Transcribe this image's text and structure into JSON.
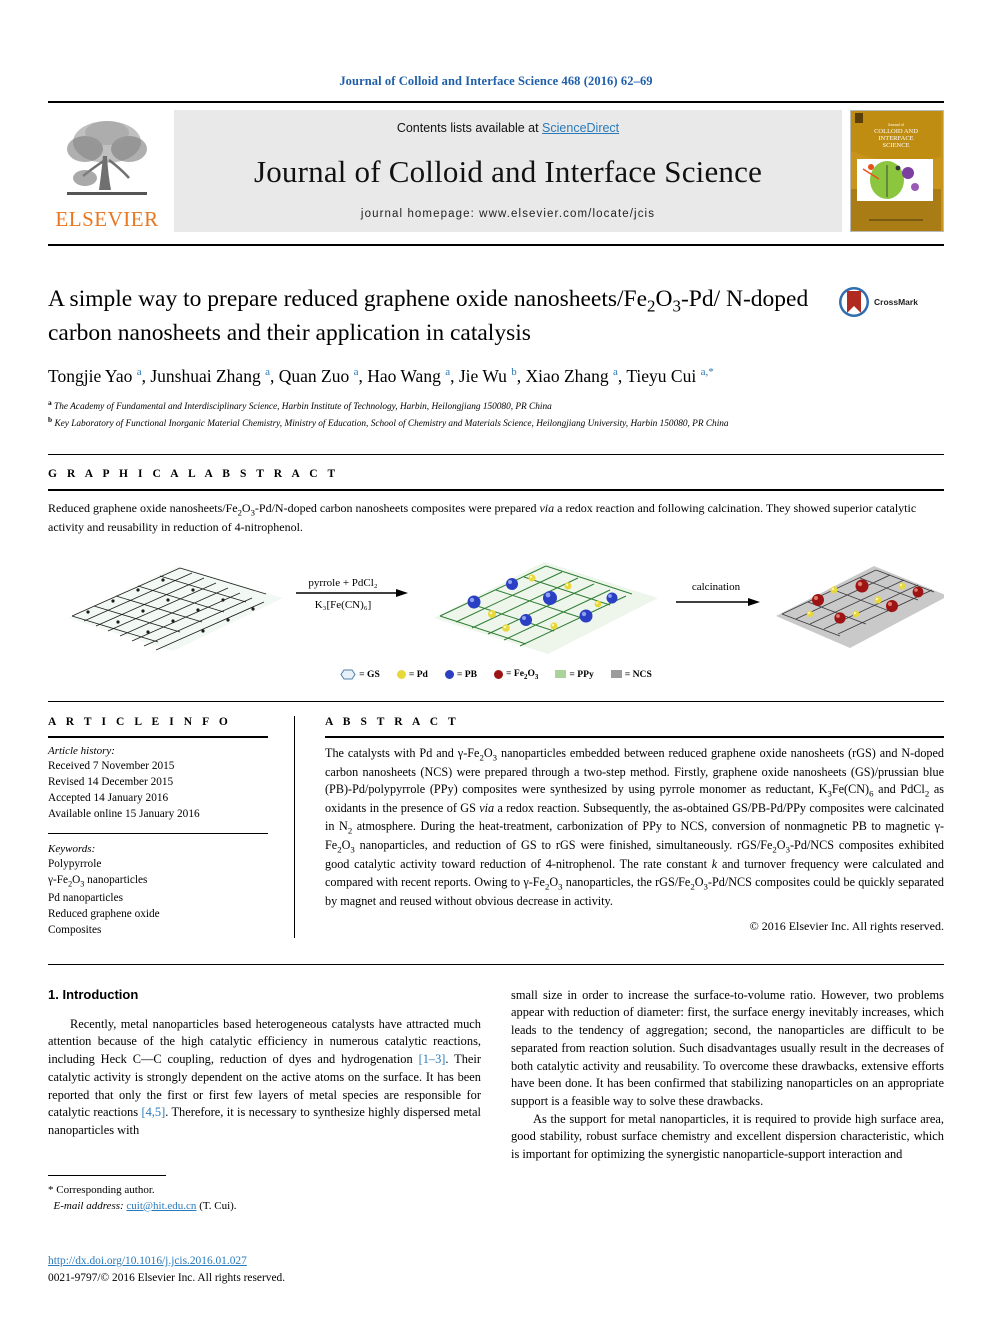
{
  "running_head": "Journal of Colloid and Interface Science 468 (2016) 62–69",
  "masthead": {
    "contents_prefix": "Contents lists available at ",
    "sciencedirect": "ScienceDirect",
    "journal_name": "Journal of Colloid and Interface Science",
    "homepage": "journal homepage: www.elsevier.com/locate/jcis",
    "publisher": "ELSEVIER",
    "cover_title": "COLLOID AND INTERFACE SCIENCE",
    "cover_overline": "Journal of"
  },
  "article": {
    "title_line1": "A simple way to prepare reduced graphene oxide nanosheets/Fe",
    "title_full": "A simple way to prepare reduced graphene oxide nanosheets/Fe2O3-Pd/ N-doped carbon nanosheets and their application in catalysis",
    "crossmark_label": "CrossMark",
    "authors": [
      {
        "name": "Tongjie Yao",
        "mark": "a"
      },
      {
        "name": "Junshuai Zhang",
        "mark": "a"
      },
      {
        "name": "Quan Zuo",
        "mark": "a"
      },
      {
        "name": "Hao Wang",
        "mark": "a"
      },
      {
        "name": "Jie Wu",
        "mark": "b"
      },
      {
        "name": "Xiao Zhang",
        "mark": "a"
      },
      {
        "name": "Tieyu Cui",
        "mark": "a,*"
      }
    ],
    "affiliations": [
      {
        "mark": "a",
        "text": "The Academy of Fundamental and Interdisciplinary Science, Harbin Institute of Technology, Harbin, Heilongjiang 150080, PR China"
      },
      {
        "mark": "b",
        "text": "Key Laboratory of Functional Inorganic Material Chemistry, Ministry of Education, School of Chemistry and Materials Science, Heilongjiang University, Harbin 150080, PR China"
      }
    ]
  },
  "graphical_abstract": {
    "heading": "G R A P H I C A L   A B S T R A C T",
    "text": "Reduced graphene oxide nanosheets/Fe2O3-Pd/N-doped carbon nanosheets composites were prepared via a redox reaction and following calcination. They showed superior catalytic activity and reusability in reduction of 4-nitrophenol.",
    "arrow1_top": "pyrrole + PdCl2",
    "arrow1_bottom": "K3[Fe(CN)6]",
    "arrow2_top": "calcination",
    "legend": [
      {
        "key": "GS",
        "symbol": "hexagon",
        "color": "#e8f1f8"
      },
      {
        "key": "Pd",
        "symbol": "dot",
        "color": "#e8d83c"
      },
      {
        "key": "PB",
        "symbol": "dot",
        "color": "#2b3fc4"
      },
      {
        "key": "Fe2O3",
        "symbol": "dot",
        "color": "#9e1414"
      },
      {
        "key": "PPy",
        "symbol": "square",
        "color": "#a9d39a"
      },
      {
        "key": "NCS",
        "symbol": "square",
        "color": "#9b9b9b"
      }
    ]
  },
  "article_info": {
    "heading": "A R T I C L E   I N F O",
    "history_title": "Article history:",
    "history": [
      "Received 7 November 2015",
      "Revised 14 December 2015",
      "Accepted 14 January 2016",
      "Available online 15 January 2016"
    ],
    "keywords_title": "Keywords:",
    "keywords": [
      "Polypyrrole",
      "γ-Fe2O3 nanoparticles",
      "Pd nanoparticles",
      "Reduced graphene oxide",
      "Composites"
    ]
  },
  "abstract": {
    "heading": "A B S T R A C T",
    "text": "The catalysts with Pd and γ-Fe2O3 nanoparticles embedded between reduced graphene oxide nanosheets (rGS) and N-doped carbon nanosheets (NCS) were prepared through a two-step method. Firstly, graphene oxide nanosheets (GS)/prussian blue (PB)-Pd/polypyrrole (PPy) composites were synthesized by using pyrrole monomer as reductant, K3Fe(CN)6 and PdCl2 as oxidants in the presence of GS via a redox reaction. Subsequently, the as-obtained GS/PB-Pd/PPy composites were calcinated in N2 atmosphere. During the heat-treatment, carbonization of PPy to NCS, conversion of nonmagnetic PB to magnetic γ-Fe2O3 nanoparticles, and reduction of GS to rGS were finished, simultaneously. rGS/Fe2O3-Pd/NCS composites exhibited good catalytic activity toward reduction of 4-nitrophenol. The rate constant k and turnover frequency were calculated and compared with recent reports. Owing to γ-Fe2O3 nanoparticles, the rGS/Fe2O3-Pd/NCS composites could be quickly separated by magnet and reused without obvious decrease in activity.",
    "copyright": "© 2016 Elsevier Inc. All rights reserved."
  },
  "body": {
    "section_title": "1. Introduction",
    "left_paragraph": "Recently, metal nanoparticles based heterogeneous catalysts have attracted much attention because of the high catalytic efficiency in numerous catalytic reactions, including Heck C—C coupling, reduction of dyes and hydrogenation [1–3]. Their catalytic activity is strongly dependent on the active atoms on the surface. It has been reported that only the first or first few layers of metal species are responsible for catalytic reactions [4,5]. Therefore, it is necessary to synthesize highly dispersed metal nanoparticles with",
    "right_paragraph_1": "small size in order to increase the surface-to-volume ratio. However, two problems appear with reduction of diameter: first, the surface energy inevitably increases, which leads to the tendency of aggregation; second, the nanoparticles are difficult to be separated from reaction solution. Such disadvantages usually result in the decreases of both catalytic activity and reusability. To overcome these drawbacks, extensive efforts have been done. It has been confirmed that stabilizing nanoparticles on an appropriate support is a feasible way to solve these drawbacks.",
    "right_paragraph_2": "As the support for metal nanoparticles, it is required to provide high surface area, good stability, robust surface chemistry and excellent dispersion characteristic, which is important for optimizing the synergistic nanoparticle-support interaction and"
  },
  "footnote": {
    "corresponding": "* Corresponding author.",
    "email_label": "E-mail address:",
    "email": "cuit@hit.edu.cn",
    "email_suffix": "(T. Cui).",
    "doi": "http://dx.doi.org/10.1016/j.jcis.2016.01.027",
    "issn": "0021-9797/© 2016 Elsevier Inc. All rights reserved."
  },
  "colors": {
    "link_blue": "#2a7ab9",
    "elsevier_orange": "#E87722",
    "crossmark_blue": "#2f6fb0",
    "crossmark_red": "#b02a1f"
  }
}
